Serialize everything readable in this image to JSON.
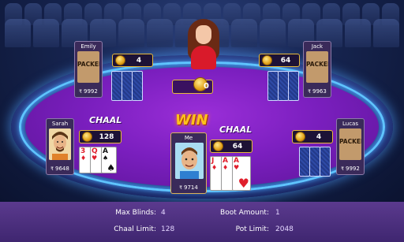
{
  "pot": {
    "amount": "0"
  },
  "win_label": "WIN",
  "players": {
    "emily": {
      "name": "Emily",
      "status": "PACKED",
      "balance": "9992",
      "bet": "4"
    },
    "jack": {
      "name": "Jack",
      "status": "PACKED",
      "balance": "9963",
      "bet": "64"
    },
    "sarah": {
      "name": "Sarah",
      "balance": "9648",
      "bet": "128",
      "action": "CHAAL",
      "cards": [
        {
          "rank": "3",
          "suit": "♦",
          "color": "red"
        },
        {
          "rank": "Q",
          "suit": "♥",
          "color": "red"
        },
        {
          "rank": "A",
          "suit": "♠",
          "color": "black"
        }
      ]
    },
    "me": {
      "name": "Me",
      "balance": "9714",
      "bet": "64",
      "action": "CHAAL",
      "cards": [
        {
          "rank": "J",
          "suit": "♦",
          "color": "red"
        },
        {
          "rank": "A",
          "suit": "♦",
          "color": "red"
        },
        {
          "rank": "A",
          "suit": "♥",
          "color": "red"
        }
      ]
    },
    "lucas": {
      "name": "Lucas",
      "status": "PACKED",
      "balance": "9992",
      "bet": "4"
    }
  },
  "currency_symbol": "₹",
  "info": {
    "max_blinds_label": "Max Blinds:",
    "max_blinds_value": "4",
    "boot_amount_label": "Boot Amount:",
    "boot_amount_value": "1",
    "chaal_limit_label": "Chaal Limit:",
    "chaal_limit_value": "128",
    "pot_limit_label": "Pot Limit:",
    "pot_limit_value": "2048"
  },
  "colors": {
    "felt": "#7b1fbf",
    "gold": "#e7b93a",
    "rim_glow": "#5fc4ff",
    "info_bar": "#5b3a8e"
  }
}
